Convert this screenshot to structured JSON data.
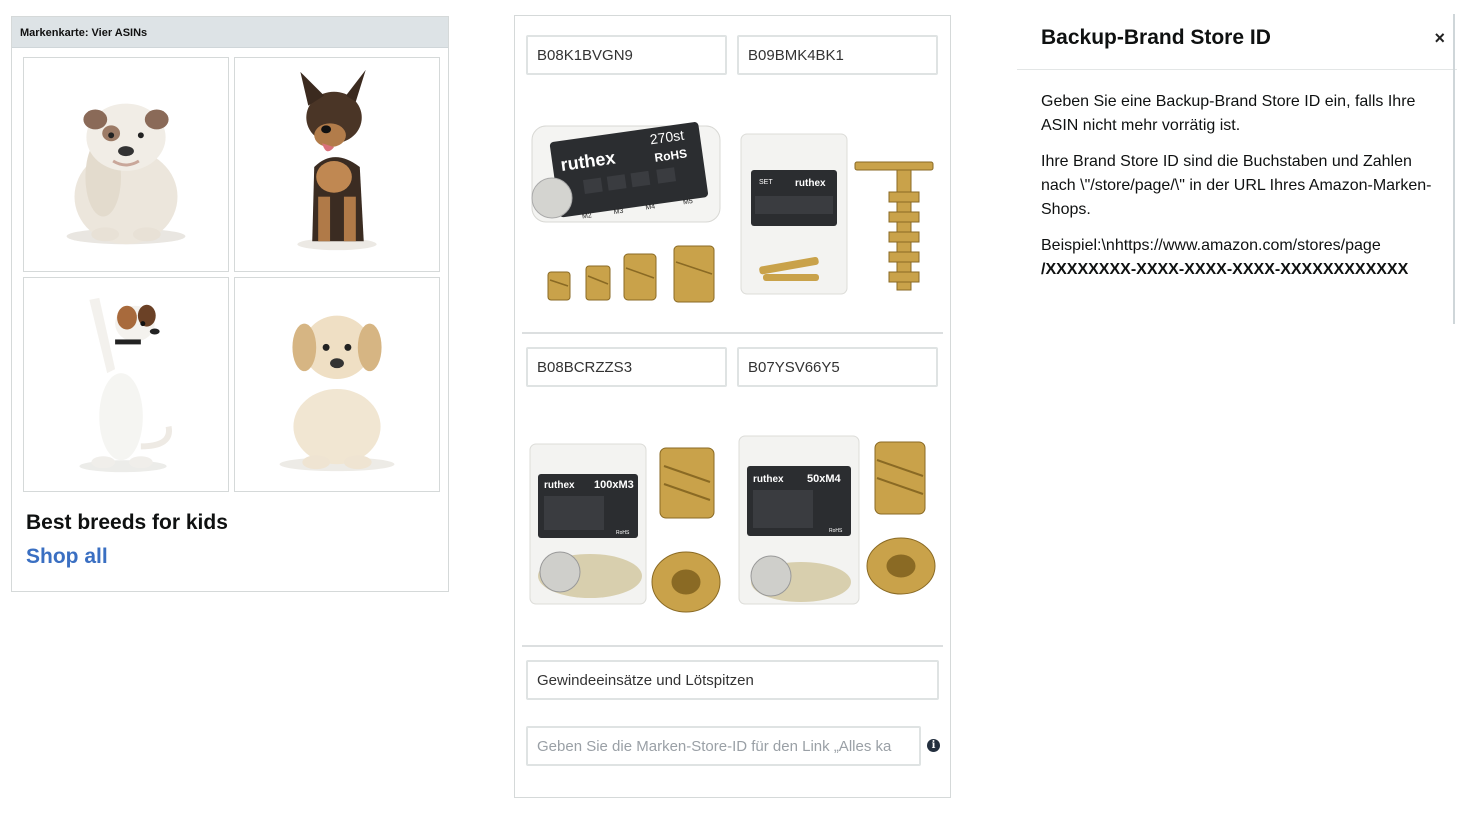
{
  "preview": {
    "header": "Markenkarte: Vier ASINs",
    "title": "Best breeds for kids",
    "link": "Shop all",
    "tiles": [
      {
        "icon": "bulldog-image"
      },
      {
        "icon": "shepherd-puppy-image"
      },
      {
        "icon": "jack-russell-image"
      },
      {
        "icon": "golden-puppy-image"
      }
    ]
  },
  "editor": {
    "asins": [
      "B08K1BVGN9",
      "B09BMK4BK1",
      "B08BCRZZS3",
      "B07YSV66Y5"
    ],
    "products": {
      "p1_brand": "ruthex",
      "p1_count": "270st",
      "p1_rohs": "RoHS",
      "p1_sizes": [
        "M2",
        "M3",
        "M4",
        "M5"
      ],
      "p2_brand": "ruthex",
      "p2_set": "SET",
      "p3_brand": "ruthex",
      "p3_qty": "100xM3",
      "p4_brand": "ruthex",
      "p4_qty": "50xM4",
      "rohs": "RoHS"
    },
    "headline_value": "Gewindeeinsätze und Lötspitzen",
    "store_id_placeholder": "Geben Sie die Marken-Store-ID für den Link „Alles ka",
    "info_glyph": "i"
  },
  "help": {
    "title": "Backup-Brand Store ID",
    "close": "×",
    "para1": "Geben Sie eine Backup-Brand Store ID ein, falls Ihre ASIN nicht mehr vorrätig ist.",
    "para2": "Ihre Brand Store ID sind die Buchstaben und Zahlen nach \\\"/store/page/\\\" in der URL Ihres Amazon-Marken-Shops.",
    "example_prefix": "Beispiel:\\nhttps://www.amazon.com/stores/page",
    "example_code": "/XXXXXXXX-XXXX-XXXX-XXXX-XXXXXXXXXXXX"
  },
  "colors": {
    "link": "#3a6fc2",
    "header_bg": "#dde3e6",
    "brass": "#c9a24a",
    "info_icon": "#232f3e"
  }
}
